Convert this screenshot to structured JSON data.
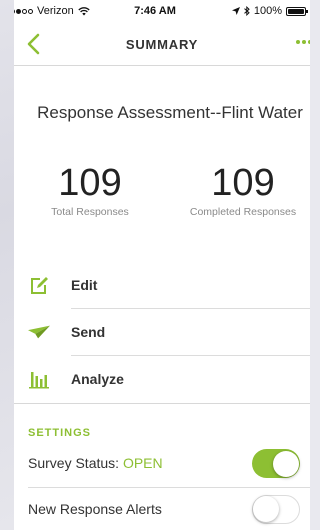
{
  "status_bar": {
    "carrier": "Verizon",
    "time": "7:46 AM",
    "battery": "100%"
  },
  "nav": {
    "title": "SUMMARY"
  },
  "survey": {
    "title": "Response Assessment--Flint Water"
  },
  "stats": {
    "total_count": "109",
    "total_label": "Total Responses",
    "completed_count": "109",
    "completed_label": "Completed Responses"
  },
  "actions": [
    {
      "label": "Edit",
      "icon": "edit-icon"
    },
    {
      "label": "Send",
      "icon": "paper-plane-icon"
    },
    {
      "label": "Analyze",
      "icon": "bar-chart-icon"
    }
  ],
  "settings": {
    "header": "SETTINGS",
    "survey_status_label": "Survey Status:",
    "survey_status_value": "OPEN",
    "survey_status_on": true,
    "alerts_label": "New Response Alerts",
    "alerts_on": false
  },
  "colors": {
    "accent": "#8dbf33",
    "text": "#333333",
    "muted": "#8a8a8a"
  }
}
